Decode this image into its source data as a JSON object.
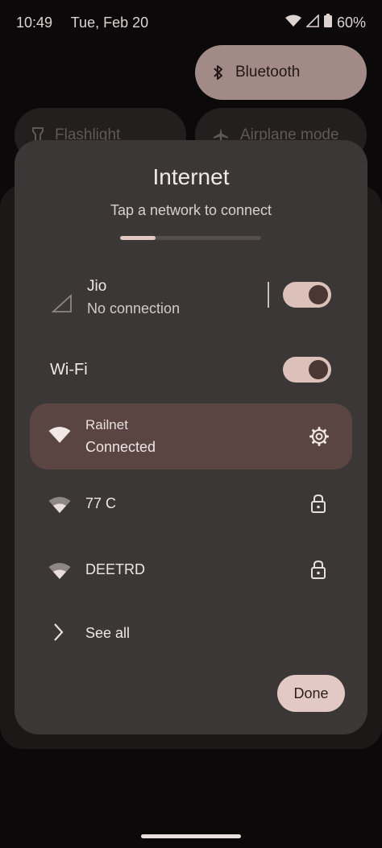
{
  "status_bar": {
    "time": "10:49",
    "date": "Tue, Feb 20",
    "battery": "60%",
    "icons": [
      "wifi-icon",
      "cell-signal-icon",
      "battery-icon"
    ]
  },
  "quick_tiles": {
    "bluetooth": {
      "label": "Bluetooth",
      "icon": "bluetooth-icon"
    },
    "flashlight": {
      "label": "Flashlight",
      "icon": "flashlight-icon"
    },
    "airplane": {
      "label": "Airplane mode",
      "icon": "airplane-icon"
    }
  },
  "dialog": {
    "title": "Internet",
    "subtitle": "Tap a network to connect",
    "scan_progress": 0.25,
    "mobile": {
      "name": "Jio",
      "status": "No connection",
      "enabled": true
    },
    "wifi": {
      "label": "Wi-Fi",
      "enabled": true
    },
    "networks": [
      {
        "name": "Railnet",
        "status": "Connected",
        "action_icon": "gear-icon"
      },
      {
        "name": "77 C",
        "action_icon": "lock-icon"
      },
      {
        "name": "DEETRD",
        "action_icon": "lock-icon"
      }
    ],
    "see_all": "See all",
    "done": "Done"
  },
  "colors": {
    "accent": "#e3c9c3",
    "dialog_bg": "#3b3736",
    "connected_bg": "#5a4542"
  }
}
